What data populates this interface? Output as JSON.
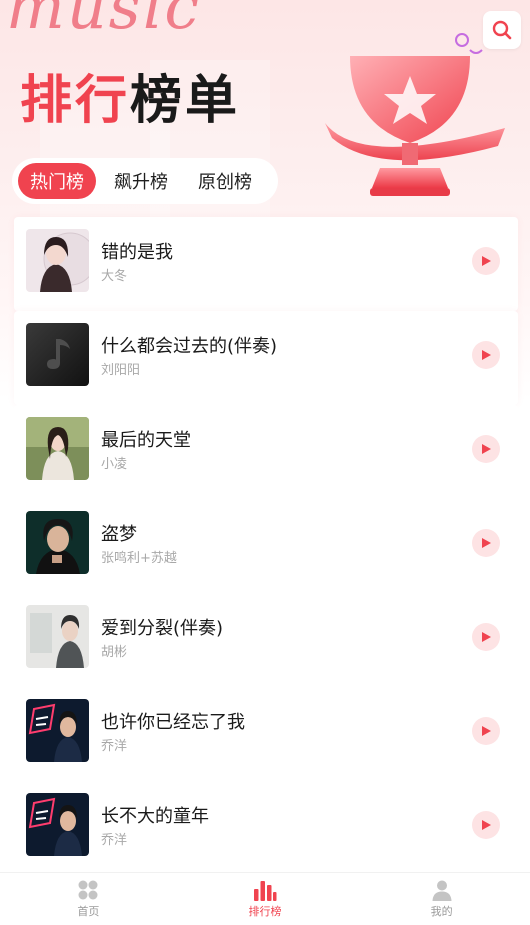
{
  "header": {
    "deco_script": "music",
    "title_red": "排行",
    "title_dark": "榜单"
  },
  "tabs": [
    {
      "label": "热门榜",
      "active": true
    },
    {
      "label": "飙升榜",
      "active": false
    },
    {
      "label": "原创榜",
      "active": false
    }
  ],
  "songs": [
    {
      "title": "错的是我",
      "artist": "大冬"
    },
    {
      "title": "什么都会过去的(伴奏)",
      "artist": "刘阳阳"
    },
    {
      "title": "最后的天堂",
      "artist": "小凌"
    },
    {
      "title": "盗梦",
      "artist": "张鸣利+苏越"
    },
    {
      "title": "爱到分裂(伴奏)",
      "artist": "胡彬"
    },
    {
      "title": "也许你已经忘了我",
      "artist": "乔洋"
    },
    {
      "title": "长不大的童年",
      "artist": "乔洋"
    }
  ],
  "tabbar": [
    {
      "label": "首页",
      "icon": "grid-icon",
      "active": false
    },
    {
      "label": "排行榜",
      "icon": "chart-bars-icon",
      "active": true
    },
    {
      "label": "我的",
      "icon": "user-icon",
      "active": false
    }
  ],
  "colors": {
    "accent": "#f0434f",
    "accent_light": "#fde3e4",
    "text_primary": "#1a1a1a",
    "text_secondary": "#a8a8a8"
  }
}
